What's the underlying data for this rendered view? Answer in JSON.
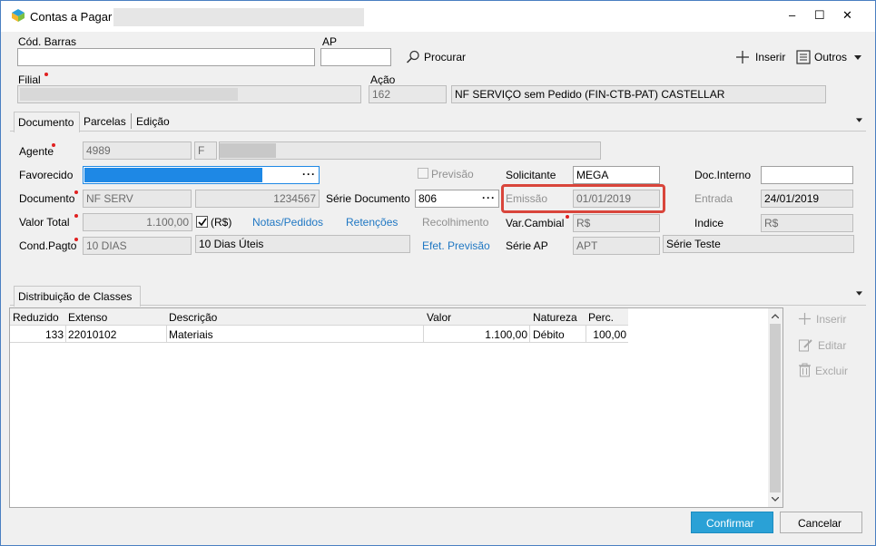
{
  "window": {
    "title": "Contas a Pagar",
    "minimize": "–",
    "maximize": "☐",
    "close": "✕"
  },
  "top": {
    "cod_barras_label": "Cód. Barras",
    "cod_barras_value": "",
    "ap_label": "AP",
    "ap_value": "",
    "procurar_label": "Procurar",
    "inserir_label": "Inserir",
    "outros_label": "Outros",
    "filial_label": "Filial",
    "acao_label": "Ação",
    "acao_code": "162",
    "acao_desc": "NF SERVIÇO sem Pedido (FIN-CTB-PAT) CASTELLAR"
  },
  "tabs": [
    {
      "label": "Documento",
      "active": true
    },
    {
      "label": "Parcelas",
      "active": false
    },
    {
      "label": "Edição",
      "active": false
    }
  ],
  "form": {
    "agente_label": "Agente",
    "agente_code": "4989",
    "agente_type": "F",
    "favorecido_label": "Favorecido",
    "previsao_label": "Previsão",
    "solicitante_label": "Solicitante",
    "solicitante_value": "MEGA",
    "doc_interno_label": "Doc.Interno",
    "doc_interno_value": "",
    "documento_label": "Documento",
    "documento_type": "NF SERV",
    "documento_number": "1234567",
    "serie_documento_label": "Série Documento",
    "serie_documento_value": "806",
    "emissao_label": "Emissão",
    "emissao_value": "01/01/2019",
    "entrada_label": "Entrada",
    "entrada_value": "24/01/2019",
    "valor_total_label": "Valor Total",
    "valor_total_value": "1.100,00",
    "currency_check_label": "(R$)",
    "notas_link": "Notas/Pedidos",
    "retencoes_link": "Retenções",
    "recolhimento_label": "Recolhimento",
    "var_cambial_label": "Var.Cambial",
    "var_cambial_value": "R$",
    "indice_label": "Indice",
    "indice_value": "R$",
    "cond_pagto_label": "Cond.Pagto",
    "cond_pagto_code": "10 DIAS",
    "cond_pagto_desc": "10 Dias Úteis",
    "efet_previsao_link": "Efet. Previsão",
    "serie_ap_label": "Série AP",
    "serie_ap_code": "APT",
    "serie_ap_desc": "Série Teste"
  },
  "classes": {
    "tab_label": "Distribuição de Classes",
    "columns": [
      "Reduzido",
      "Extenso",
      "Descrição",
      "Valor",
      "Natureza",
      "Perc."
    ],
    "rows": [
      {
        "reduzido": "133",
        "extenso": "22010102",
        "descricao": "Materiais",
        "valor": "1.100,00",
        "natureza": "Débito",
        "perc": "100,00"
      }
    ],
    "inserir": "Inserir",
    "editar": "Editar",
    "excluir": "Excluir"
  },
  "footer": {
    "confirmar": "Confirmar",
    "cancelar": "Cancelar"
  },
  "colors": {
    "highlight": "#d9453b",
    "link": "#1f77c3",
    "primary_button": "#2aa1d6",
    "selected_field": "#1e88e5"
  }
}
